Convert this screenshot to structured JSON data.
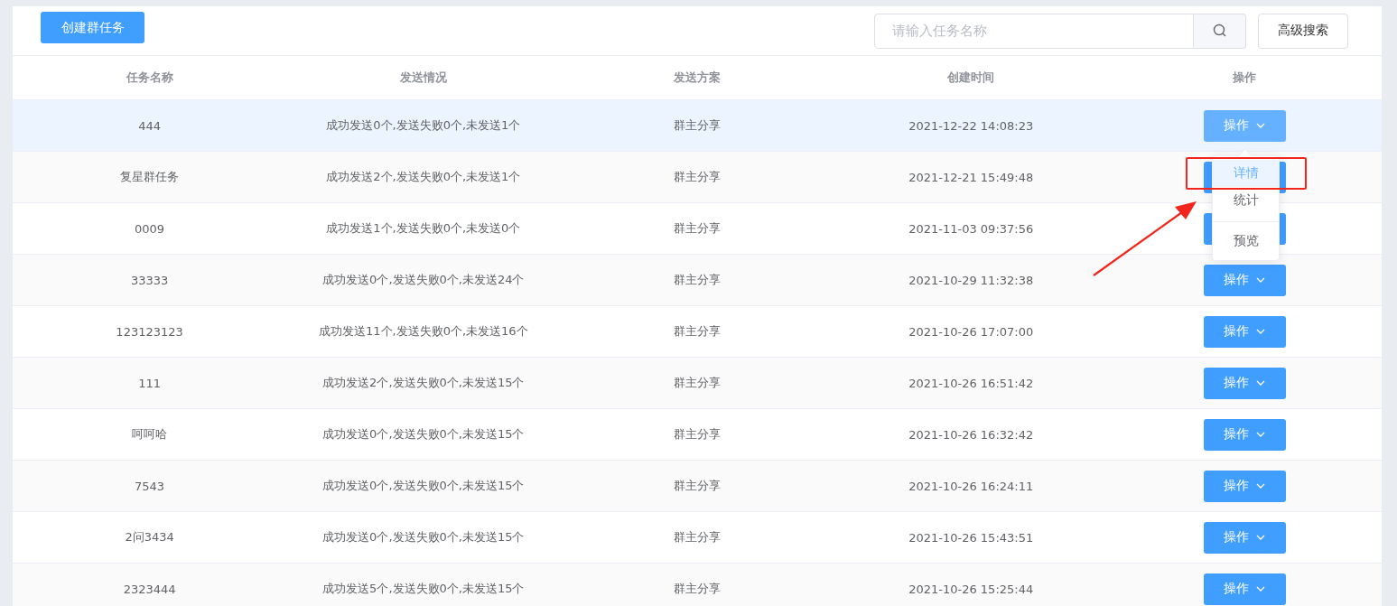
{
  "toolbar": {
    "create_button": "创建群任务",
    "search": {
      "placeholder": "请输入任务名称"
    },
    "advanced_search": "高级搜索"
  },
  "table": {
    "columns": [
      "任务名称",
      "发送情况",
      "发送方案",
      "创建时间",
      "操作"
    ],
    "rows": [
      {
        "name": "444",
        "status": "成功发送0个,发送失败0个,未发送1个",
        "plan": "群主分享",
        "created": "2021-12-22 14:08:23",
        "action": "操作",
        "hovered": true
      },
      {
        "name": "复星群任务",
        "status": "成功发送2个,发送失败0个,未发送1个",
        "plan": "群主分享",
        "created": "2021-12-21 15:49:48",
        "hovered": false
      },
      {
        "name": "0009",
        "status": "成功发送1个,发送失败0个,未发送0个",
        "plan": "群主分享",
        "created": "2021-11-03 09:37:56",
        "hovered": false
      },
      {
        "name": "33333",
        "status": "成功发送0个,发送失败0个,未发送24个",
        "plan": "群主分享",
        "created": "2021-10-29 11:32:38",
        "action": "操作",
        "hovered": false
      },
      {
        "name": "123123123",
        "status": "成功发送11个,发送失败0个,未发送16个",
        "plan": "群主分享",
        "created": "2021-10-26 17:07:00",
        "action": "操作",
        "hovered": false
      },
      {
        "name": "111",
        "status": "成功发送2个,发送失败0个,未发送15个",
        "plan": "群主分享",
        "created": "2021-10-26 16:51:42",
        "action": "操作",
        "hovered": false
      },
      {
        "name": "呵呵哈",
        "status": "成功发送0个,发送失败0个,未发送15个",
        "plan": "群主分享",
        "created": "2021-10-26 16:32:42",
        "action": "操作",
        "hovered": false
      },
      {
        "name": "7543",
        "status": "成功发送0个,发送失败0个,未发送15个",
        "plan": "群主分享",
        "created": "2021-10-26 16:24:11",
        "action": "操作",
        "hovered": false
      },
      {
        "name": "2问3434",
        "status": "成功发送0个,发送失败0个,未发送15个",
        "plan": "群主分享",
        "created": "2021-10-26 15:43:51",
        "action": "操作",
        "hovered": false
      },
      {
        "name": "2323444",
        "status": "成功发送5个,发送失败0个,未发送15个",
        "plan": "群主分享",
        "created": "2021-10-26 15:25:44",
        "action": "操作",
        "hovered": false
      }
    ]
  },
  "dropdown": {
    "items": [
      {
        "label": "详情",
        "hovered": true
      },
      {
        "label": "统计",
        "hovered": false
      },
      {
        "label": "预览",
        "hovered": false
      }
    ]
  }
}
